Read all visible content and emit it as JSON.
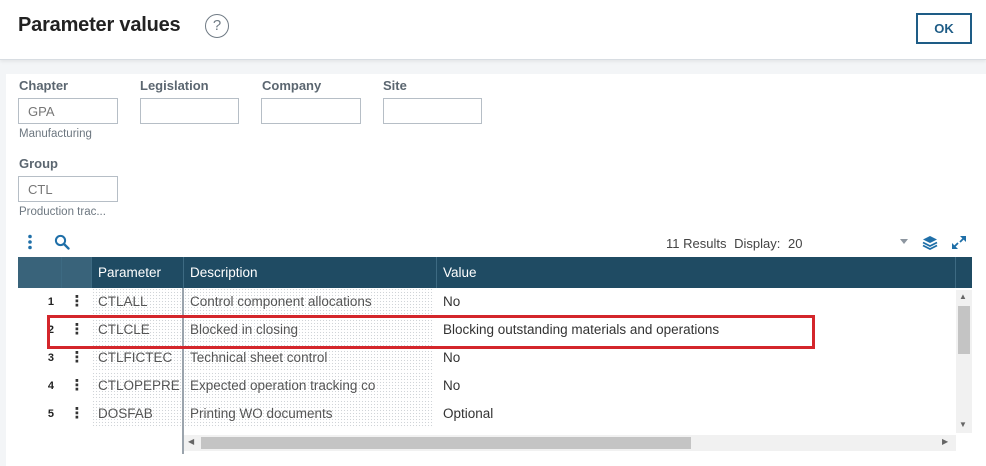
{
  "header": {
    "title": "Parameter values",
    "help_icon": "?",
    "ok_label": "OK"
  },
  "filters": {
    "chapter": {
      "label": "Chapter",
      "value": "GPA",
      "sub": "Manufacturing"
    },
    "legislation": {
      "label": "Legislation",
      "value": ""
    },
    "company": {
      "label": "Company",
      "value": ""
    },
    "site": {
      "label": "Site",
      "value": ""
    },
    "group": {
      "label": "Group",
      "value": "CTL",
      "sub": "Production trac..."
    }
  },
  "toolbar": {
    "results_text": "11 Results",
    "display_label": "Display:",
    "display_value": "20",
    "icons": [
      "vertical-dots-icon",
      "search-icon",
      "layers-icon",
      "expand-icon"
    ]
  },
  "grid": {
    "columns": [
      "Parameter",
      "Description",
      "Value"
    ],
    "rows": [
      {
        "num": "1",
        "parameter": "CTLALL",
        "description": "Control component allocations",
        "value": "No"
      },
      {
        "num": "2",
        "parameter": "CTLCLE",
        "description": "Blocked in closing",
        "value": "Blocking outstanding materials and operations"
      },
      {
        "num": "3",
        "parameter": "CTLFICTEC",
        "description": "Technical sheet control",
        "value": "No"
      },
      {
        "num": "4",
        "parameter": "CTLOPEPRE",
        "description": "Expected operation tracking co",
        "value": "No"
      },
      {
        "num": "5",
        "parameter": "DOSFAB",
        "description": "Printing WO documents",
        "value": "Optional"
      }
    ]
  },
  "colors": {
    "header_bg": "#1f4b63",
    "accent": "#1f6fa8",
    "highlight": "#d4262b"
  }
}
